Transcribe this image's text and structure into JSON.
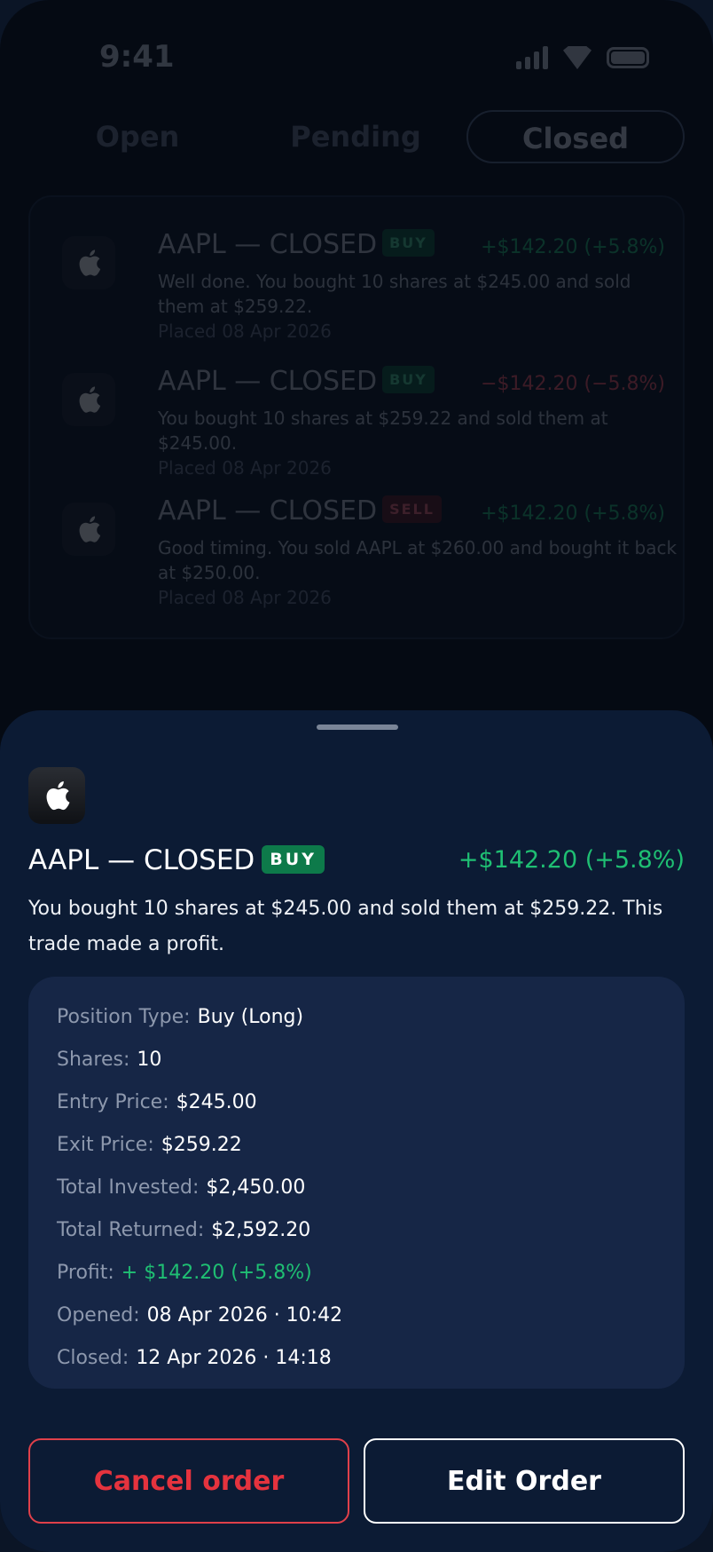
{
  "status_bar": {
    "time": "9:41"
  },
  "tabs": [
    {
      "label": "Open"
    },
    {
      "label": "Pending"
    },
    {
      "label": "Closed"
    }
  ],
  "orders": [
    {
      "title": "AAPL — CLOSED",
      "badge": "BUY",
      "change": "+$142.20 (+5.8%)",
      "description": "Well done. You bought 10 shares at $245.00 and sold them at $259.22.",
      "placed": "Placed 08 Apr 2026"
    },
    {
      "title": "AAPL — CLOSED",
      "badge": "BUY",
      "change": "−$142.20 (−5.8%)",
      "description": "You bought 10 shares at $259.22 and sold them at $245.00.",
      "placed": "Placed 08 Apr 2026"
    },
    {
      "title": "AAPL — CLOSED",
      "badge": "SELL",
      "change": "+$142.20 (+5.8%)",
      "description": "Good timing. You sold AAPL at $260.00 and bought it back at $250.00.",
      "placed": "Placed 08 Apr 2026"
    }
  ],
  "sheet": {
    "title": "AAPL — CLOSED",
    "badge": "BUY",
    "change": "+$142.20 (+5.8%)",
    "description": "You bought 10 shares at $245.00 and sold them at $259.22. This trade made a profit.",
    "details": [
      {
        "label": "Position Type:",
        "value": "Buy (Long)"
      },
      {
        "label": "Shares:",
        "value": "10"
      },
      {
        "label": "Entry Price:",
        "value": "$245.00"
      },
      {
        "label": "Exit Price:",
        "value": "$259.22"
      },
      {
        "label": "Total Invested:",
        "value": "$2,450.00"
      },
      {
        "label": "Total Returned:",
        "value": "$2,592.20"
      },
      {
        "label": "Profit:",
        "value": "+ $142.20 (+5.8%)"
      },
      {
        "label": "Opened:",
        "value": "08 Apr 2026 · 10:42"
      },
      {
        "label": "Closed:",
        "value": "12 Apr 2026 · 14:18"
      }
    ],
    "cancel_label": "Cancel order",
    "edit_label": "Edit Order"
  },
  "colors": {
    "positive": "#1fbf73",
    "negative": "#ff5a6a",
    "buy_badge": "#0d7a4a",
    "danger": "#e5333e",
    "sheet_bg": "#0c1b34",
    "card_bg": "#162646"
  },
  "icons": {
    "logo": "apple-logo-icon"
  }
}
